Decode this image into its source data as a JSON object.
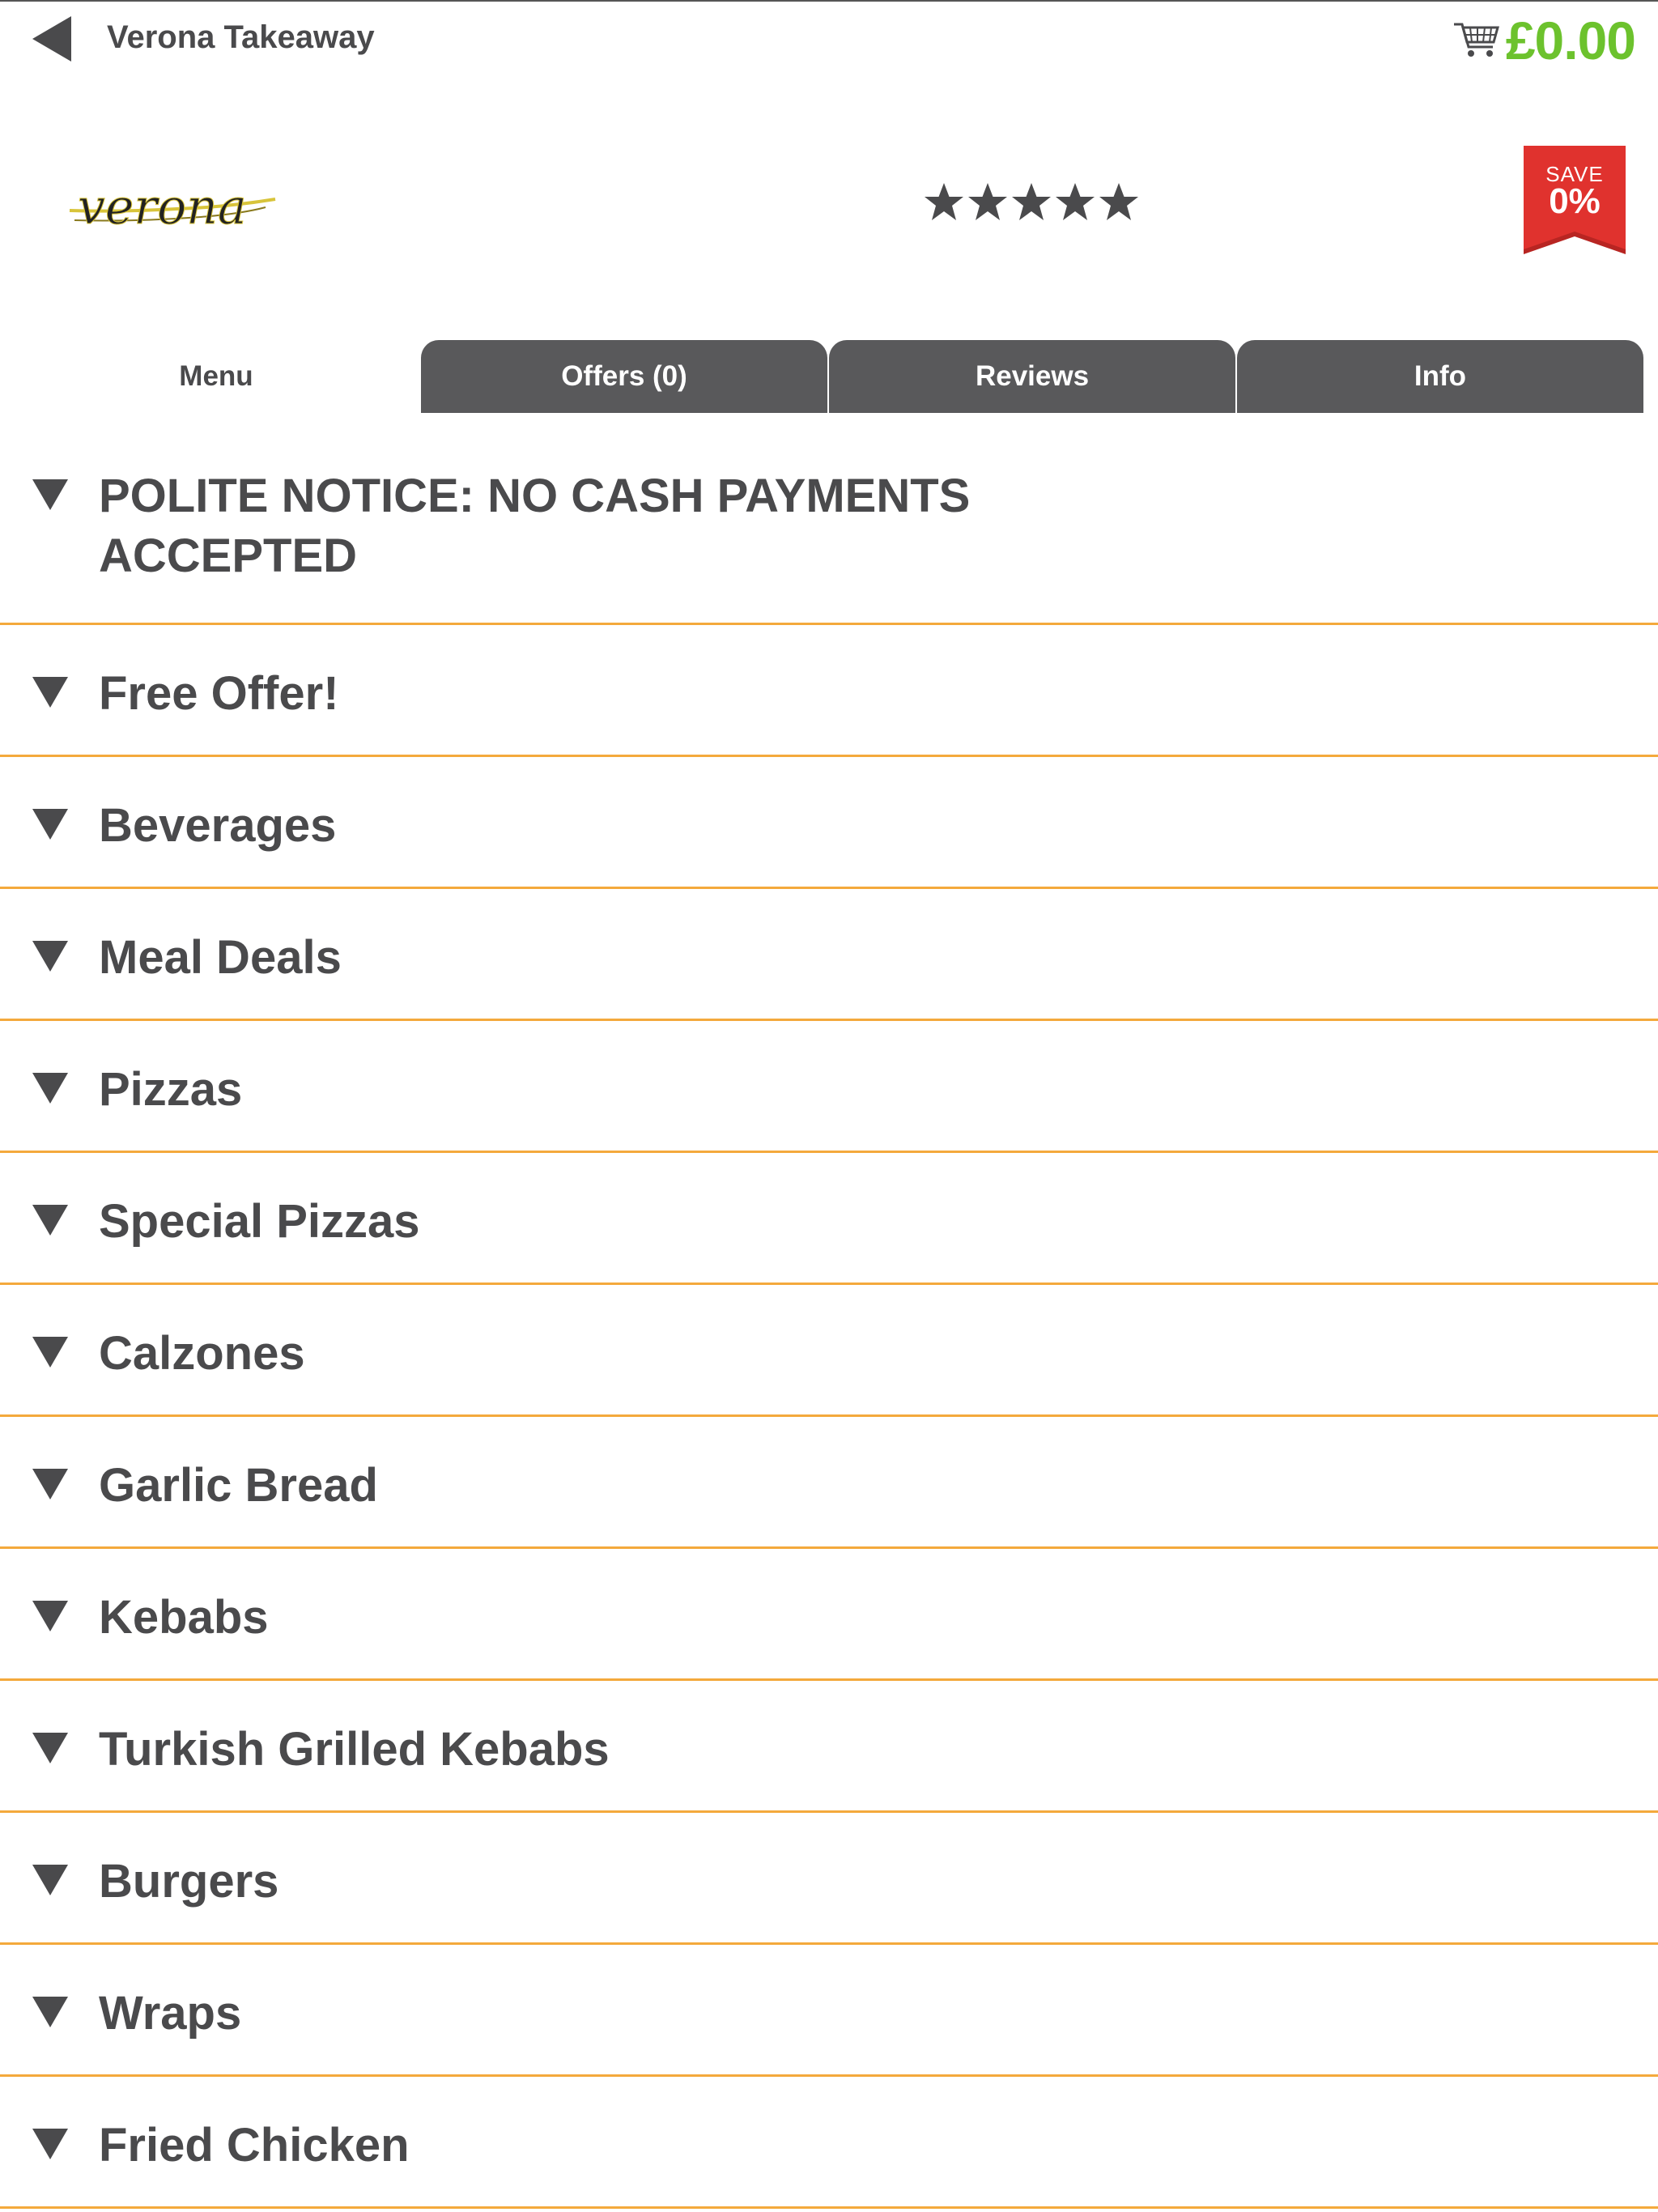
{
  "header": {
    "title": "Verona Takeaway",
    "cart_amount": "£0.00",
    "accent_color": "#6cc22d"
  },
  "restaurant": {
    "logo_text": "verona",
    "rating_stars": 5,
    "save_label": "SAVE",
    "save_value": "0%",
    "save_color": "#e0322e"
  },
  "tabs": [
    {
      "label": "Menu",
      "active": true
    },
    {
      "label": "Offers (0)",
      "active": false
    },
    {
      "label": "Reviews",
      "active": false
    },
    {
      "label": "Info",
      "active": false
    }
  ],
  "categories": [
    "POLITE NOTICE: NO CASH PAYMENTS ACCEPTED",
    "Free Offer!",
    "Beverages",
    "Meal Deals",
    "Pizzas",
    "Special Pizzas",
    "Calzones",
    "Garlic Bread",
    "Kebabs",
    "Turkish Grilled Kebabs",
    "Burgers",
    "Wraps",
    "Fried Chicken"
  ],
  "divider_color": "#f4a93c"
}
